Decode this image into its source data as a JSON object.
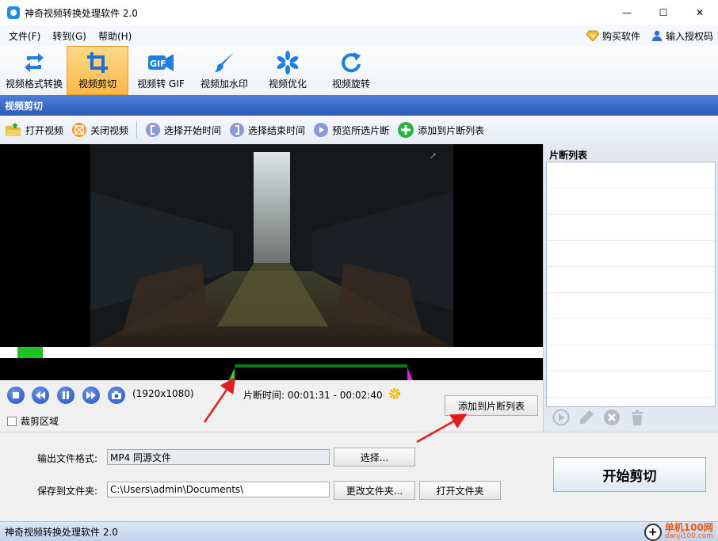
{
  "window": {
    "title": "神奇视频转换处理软件 2.0",
    "minimize_glyph": "—",
    "maximize_glyph": "☐",
    "close_glyph": "✕"
  },
  "menu": {
    "items": [
      "文件(F)",
      "转到(G)",
      "帮助(H)"
    ],
    "buy": "购买软件",
    "license": "输入授权码"
  },
  "toolbar": {
    "tools": [
      {
        "label": "视频格式转换",
        "icon": "convert-icon"
      },
      {
        "label": "视频剪切",
        "icon": "crop-icon",
        "active": true
      },
      {
        "label": "视频转 GIF",
        "icon": "gif-icon"
      },
      {
        "label": "视频加水印",
        "icon": "brush-icon"
      },
      {
        "label": "视频优化",
        "icon": "pinwheel-icon"
      },
      {
        "label": "视频旋转",
        "icon": "rotate-icon"
      }
    ],
    "gif_icon_text": "GIF"
  },
  "section": {
    "title": "视频剪切"
  },
  "actions": {
    "open": "打开视频",
    "close": "关闭视频",
    "start": "选择开始时间",
    "end": "选择结束时间",
    "preview": "预览所选片断",
    "add": "添加到片断列表"
  },
  "player": {
    "resolution": "(1920x1080)",
    "clip_time_label": "片断时间:",
    "clip_time_value": "00:01:31 - 00:02:40",
    "add_button": "添加到片断列表",
    "crop_region": "裁剪区域",
    "progress": 0.047,
    "selection_start_fraction": 0.432,
    "selection_end_fraction": 0.75
  },
  "clip_list": {
    "title": "片断列表",
    "rows": 9
  },
  "output": {
    "format_label": "输出文件格式:",
    "format_value": "MP4 同源文件",
    "select_button": "选择...",
    "folder_label": "保存到文件夹:",
    "folder_value": "C:\\Users\\admin\\Documents\\",
    "change_folder_button": "更改文件夹...",
    "open_folder_button": "打开文件夹",
    "start_button": "开始剪切"
  },
  "status": {
    "text": "神奇视频转换处理软件 2.0",
    "watermark_top": "单机100网",
    "watermark_bottom": "danji100.com"
  },
  "colors": {
    "accent_blue": "#2a5bb8",
    "active_tool": "#f9b848",
    "progress_green": "#1fc21f",
    "selection_green": "#0d7a16",
    "marker_magenta": "#e020e0",
    "annotation_red": "#e11d1d"
  }
}
